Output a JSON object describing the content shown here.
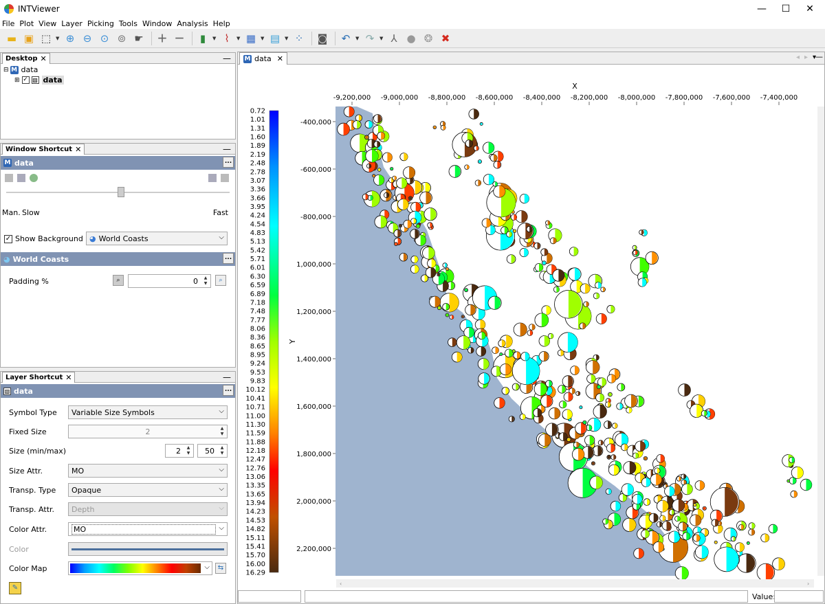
{
  "app": {
    "title": "INTViewer"
  },
  "window_controls": {
    "minimize": "—",
    "maximize": "☐",
    "close": "✕"
  },
  "menu": [
    "File",
    "Plot",
    "View",
    "Layer",
    "Picking",
    "Tools",
    "Window",
    "Analysis",
    "Help"
  ],
  "toolbar": {
    "icons": [
      "open-folder-icon",
      "open-project-icon",
      "zoom-rectangle-icon",
      "zoom-in-icon",
      "zoom-out-icon",
      "zoom-fit-icon",
      "pan-icon",
      "add-icon",
      "remove-icon",
      "bar-chart-icon",
      "line-chart-icon",
      "colormap-icon",
      "gradient-icon",
      "scatter-icon",
      "camera-icon",
      "undo-icon",
      "redo-icon",
      "split-icon",
      "bulb-icon",
      "brain-icon",
      "close-red-icon"
    ]
  },
  "desktop": {
    "tab_label": "Desktop",
    "tree": {
      "root": "data",
      "child": "data"
    }
  },
  "window_shortcut": {
    "tab_label": "Window Shortcut",
    "section": "data",
    "slider_labels": {
      "left": "Man.",
      "mid": "Slow",
      "right": "Fast"
    },
    "slider_value": 0.6,
    "show_background_label": "Show Background",
    "show_background_checked": true,
    "background_value": "World Coasts",
    "world_coasts_section": "World Coasts",
    "padding_label": "Padding %",
    "padding_value": "0"
  },
  "layer_shortcut": {
    "tab_label": "Layer Shortcut",
    "section": "data",
    "symbol_type_label": "Symbol Type",
    "symbol_type_value": "Variable Size Symbols",
    "fixed_size_label": "Fixed Size",
    "fixed_size_value": "2",
    "size_minmax_label": "Size (min/max)",
    "size_min": "2",
    "size_max": "50",
    "size_attr_label": "Size Attr.",
    "size_attr_value": "MO",
    "transp_type_label": "Transp. Type",
    "transp_type_value": "Opaque",
    "transp_attr_label": "Transp. Attr.",
    "transp_attr_value": "Depth",
    "color_attr_label": "Color Attr.",
    "color_attr_value": "MO",
    "color_label": "Color",
    "color_map_label": "Color Map"
  },
  "viewer": {
    "tab_label": "data",
    "x_axis_title": "X",
    "y_axis_title": "Y",
    "x_ticks": [
      "-9,200,000",
      "-9,000,000",
      "-8,800,000",
      "-8,600,000",
      "-8,400,000",
      "-8,200,000",
      "-8,000,000",
      "-7,800,000",
      "-7,600,000",
      "-7,400,000"
    ],
    "y_ticks": [
      "-400,000",
      "-600,000",
      "-800,000",
      "1,000,000",
      "1,200,000",
      "1,400,000",
      "1,600,000",
      "1,800,000",
      "2,000,000",
      "2,200,000"
    ],
    "colorbar_labels": [
      "0.72",
      "1.01",
      "1.31",
      "1.60",
      "1.89",
      "2.19",
      "2.48",
      "2.78",
      "3.07",
      "3.36",
      "3.66",
      "3.95",
      "4.24",
      "4.54",
      "4.83",
      "5.13",
      "5.42",
      "5.71",
      "6.01",
      "6.30",
      "6.59",
      "6.89",
      "7.18",
      "7.48",
      "7.77",
      "8.06",
      "8.36",
      "8.65",
      "8.95",
      "9.24",
      "9.53",
      "9.83",
      "10.12",
      "10.41",
      "10.71",
      "11.00",
      "11.30",
      "11.59",
      "11.88",
      "12.18",
      "12.47",
      "12.76",
      "13.06",
      "13.35",
      "13.65",
      "13.94",
      "14.23",
      "14.53",
      "14.82",
      "15.11",
      "15.41",
      "15.70",
      "16.00",
      "16.29"
    ],
    "value_label": "Value:",
    "colors": {
      "ocean": "#9fb4cf",
      "land": "#ffffff"
    }
  }
}
